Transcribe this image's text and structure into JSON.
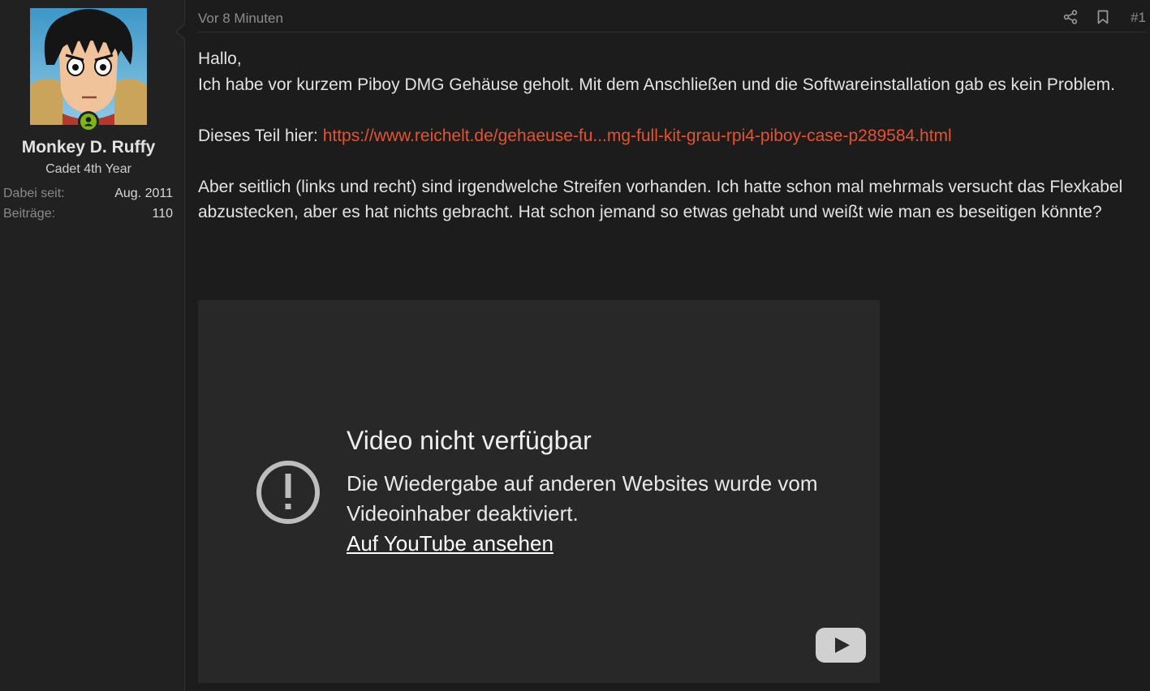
{
  "user": {
    "name": "Monkey D. Ruffy",
    "title": "Cadet 4th Year",
    "stats": [
      {
        "label": "Dabei seit:",
        "value": "Aug. 2011"
      },
      {
        "label": "Beiträge:",
        "value": "110"
      }
    ],
    "avatar_icon": "anime-avatar",
    "online_color": "#7cb518"
  },
  "post": {
    "time": "Vor 8 Minuten",
    "number": "#1",
    "share_icon": "share-icon",
    "bookmark_icon": "bookmark-icon",
    "greeting": "Hallo,",
    "line1": "Ich habe vor kurzem Piboy DMG Gehäuse geholt. Mit dem Anschließen und die Softwareinstallation gab es kein Problem.",
    "link_prefix": "Dieses Teil hier: ",
    "link_text": "https://www.reichelt.de/gehaeuse-fu...mg-full-kit-grau-rpi4-piboy-case-p289584.html",
    "paragraph2": "Aber seitlich (links und recht) sind irgendwelche Streifen vorhanden. Ich hatte schon mal mehrmals versucht das Flexkabel abzustecken, aber es hat nichts gebracht. Hat schon jemand so etwas gehabt und weißt wie man es beseitigen könnte?",
    "link_color": "#e8522a"
  },
  "video": {
    "title": "Video nicht verfügbar",
    "message": "Die Wiedergabe auf anderen Websites wurde vom Videoinhaber deaktiviert.",
    "youtube_link": "Auf YouTube ansehen",
    "warning_icon": "exclamation-circle-icon",
    "logo_icon": "youtube-logo-icon"
  }
}
